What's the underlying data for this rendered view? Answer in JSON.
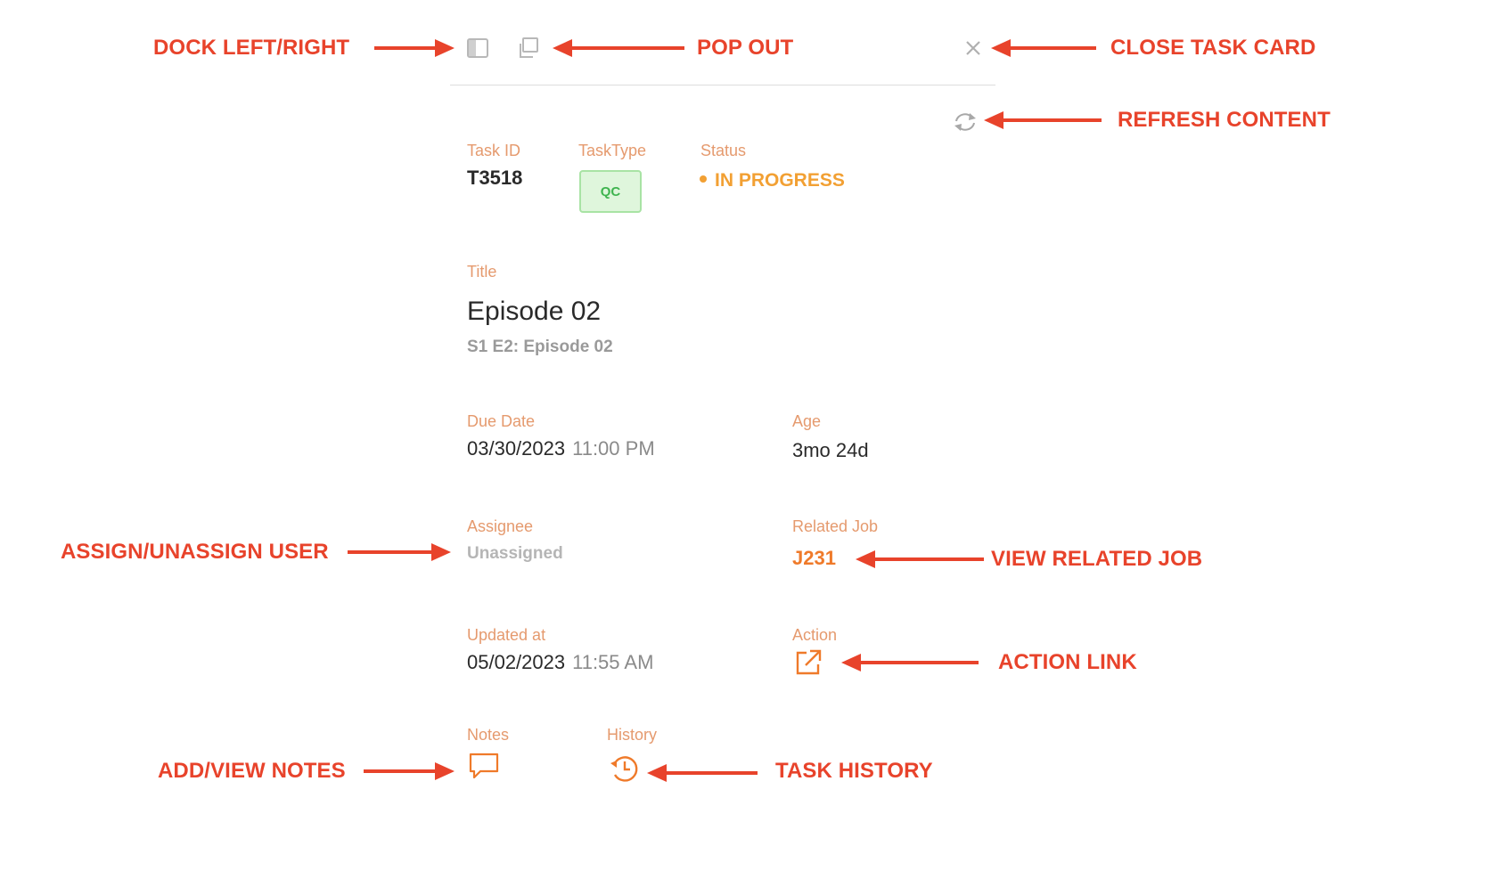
{
  "annotations": {
    "dock": "DOCK LEFT/RIGHT",
    "pop_out": "POP OUT",
    "close": "CLOSE TASK CARD",
    "refresh": "REFRESH CONTENT",
    "assign": "ASSIGN/UNASSIGN USER",
    "related_job": "VIEW RELATED JOB",
    "action": "ACTION LINK",
    "notes": "ADD/VIEW NOTES",
    "history": "TASK HISTORY"
  },
  "toolbar": {
    "dock_icon": "dock-panel-icon",
    "popout_icon": "pop-out-icon",
    "close_icon": "close-icon",
    "refresh_icon": "refresh-icon"
  },
  "task": {
    "task_id_label": "Task ID",
    "task_id": "T3518",
    "task_type_label": "TaskType",
    "task_type": "QC",
    "status_label": "Status",
    "status": "IN PROGRESS",
    "title_label": "Title",
    "title": "Episode 02",
    "subtitle": "S1 E2: Episode 02",
    "due_label": "Due Date",
    "due_date": "03/30/2023",
    "due_time": "11:00 PM",
    "age_label": "Age",
    "age": "3mo 24d",
    "assignee_label": "Assignee",
    "assignee": "Unassigned",
    "related_label": "Related Job",
    "related_job": "J231",
    "updated_label": "Updated at",
    "updated_date": "05/02/2023",
    "updated_time": "11:55 AM",
    "action_label": "Action",
    "notes_label": "Notes",
    "history_label": "History"
  },
  "colors": {
    "annotation": "#e8432b",
    "label": "#e59a6e",
    "status": "#f2a033",
    "link": "#ef7a2a",
    "badge_bg": "#dff6dc",
    "badge_text": "#3fb44f"
  }
}
